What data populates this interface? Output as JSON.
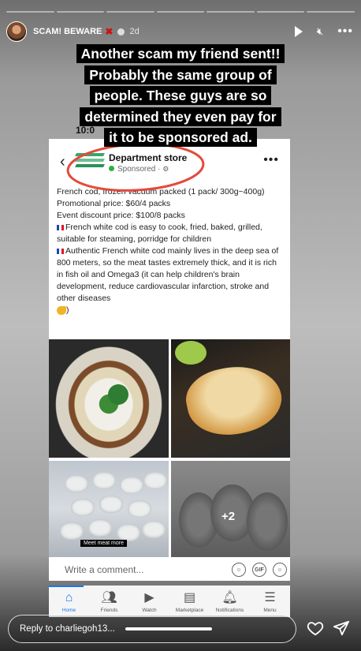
{
  "progress": {
    "segments": 7,
    "done": 0
  },
  "header": {
    "username": "SCAM! BEWARE",
    "time": "2d"
  },
  "caption": {
    "lines": [
      "Another scam my friend sent!!",
      "Probably the same group of",
      "people. These guys are so",
      "determined they even pay for",
      "it to be sponsored ad."
    ]
  },
  "screenshot": {
    "status_time": "10:0",
    "page_name": "Department store",
    "sponsored": "Sponsored ·",
    "body": [
      "French cod, frozen vacuum packed (1 pack/ 300g~400g)",
      "Promotional price: $60/4 packs",
      "Event discount price: $100/8 packs",
      "French white cod is easy to cook, fried, baked, grilled, suitable for steaming, porridge for children",
      "Authentic French white cod mainly lives in the deep sea of 800 meters, so the meat tastes extremely thick, and it is rich in fish oil and Omega3 (it can help children's brain development, reduce cardiovascular infarction, stroke and other diseases",
      ")"
    ],
    "photo_label": "Meet meat more",
    "more_photos": "+2",
    "comment_placeholder": "Write a comment...",
    "gif_label": "GIF",
    "nav": [
      {
        "label": "Home",
        "icon": "home-icon"
      },
      {
        "label": "Friends",
        "icon": "friends-icon"
      },
      {
        "label": "Watch",
        "icon": "watch-icon"
      },
      {
        "label": "Marketplace",
        "icon": "marketplace-icon"
      },
      {
        "label": "Notifications",
        "icon": "bell-icon"
      },
      {
        "label": "Menu",
        "icon": "menu-icon"
      }
    ],
    "accent": "#1877f2"
  },
  "reply": {
    "placeholder": "Reply to charliegoh13..."
  },
  "colors": {
    "circle": "#e44a3b",
    "caption_bg": "#000000"
  }
}
